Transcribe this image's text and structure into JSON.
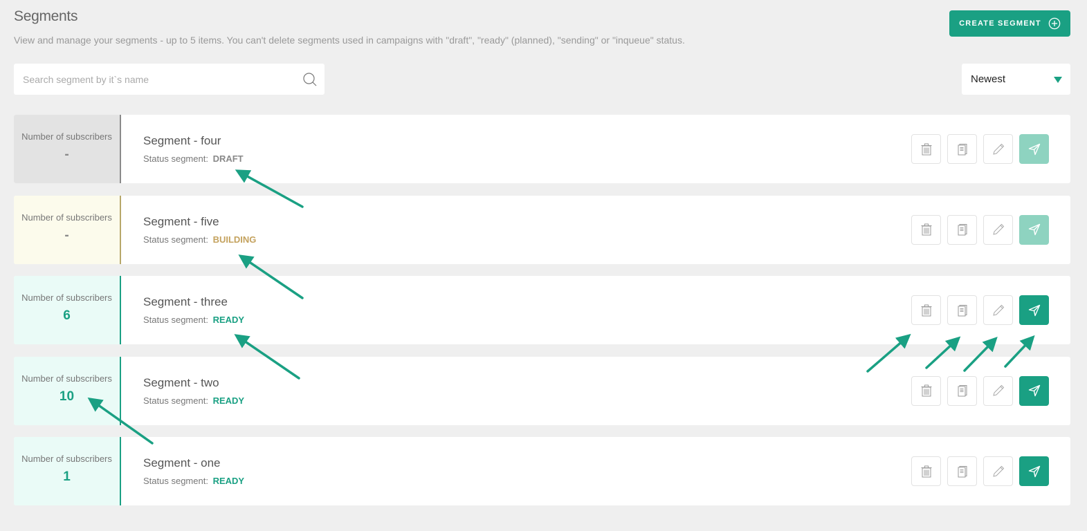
{
  "header": {
    "title": "Segments",
    "description": "View and manage your segments - up to 5 items. You can't delete segments used in campaigns with \"draft\", \"ready\" (planned), \"sending\" or \"inqueue\" status.",
    "create_button_label": "CREATE SEGMENT",
    "create_button_icon": "plus-circle-icon"
  },
  "search": {
    "placeholder": "Search segment by it`s name",
    "value": "",
    "icon": "search-icon"
  },
  "sort": {
    "selected": "Newest"
  },
  "colors": {
    "accent": "#1aa083",
    "accent_disabled": "#8ed3c0",
    "draft": "#888888",
    "building": "#c4a25e",
    "ready": "#1aa083",
    "annotation_arrow": "#1aa083"
  },
  "segments": [
    {
      "name": "Segment - four",
      "subscribers_label": "Number of subscribers",
      "subscribers": "-",
      "status_label": "Status segment:",
      "status": "DRAFT",
      "state": "draft",
      "send_enabled": false
    },
    {
      "name": "Segment - five",
      "subscribers_label": "Number of subscribers",
      "subscribers": "-",
      "status_label": "Status segment:",
      "status": "BUILDING",
      "state": "building",
      "send_enabled": false
    },
    {
      "name": "Segment - three",
      "subscribers_label": "Number of subscribers",
      "subscribers": "6",
      "status_label": "Status segment:",
      "status": "READY",
      "state": "ready",
      "send_enabled": true
    },
    {
      "name": "Segment - two",
      "subscribers_label": "Number of subscribers",
      "subscribers": "10",
      "status_label": "Status segment:",
      "status": "READY",
      "state": "ready",
      "send_enabled": true
    },
    {
      "name": "Segment - one",
      "subscribers_label": "Number of subscribers",
      "subscribers": "1",
      "status_label": "Status segment:",
      "status": "READY",
      "state": "ready",
      "send_enabled": true
    }
  ],
  "actions": [
    {
      "name": "delete",
      "icon": "trash-icon"
    },
    {
      "name": "duplicate",
      "icon": "copy-icon"
    },
    {
      "name": "edit",
      "icon": "pencil-icon"
    },
    {
      "name": "send",
      "icon": "send-icon"
    }
  ]
}
